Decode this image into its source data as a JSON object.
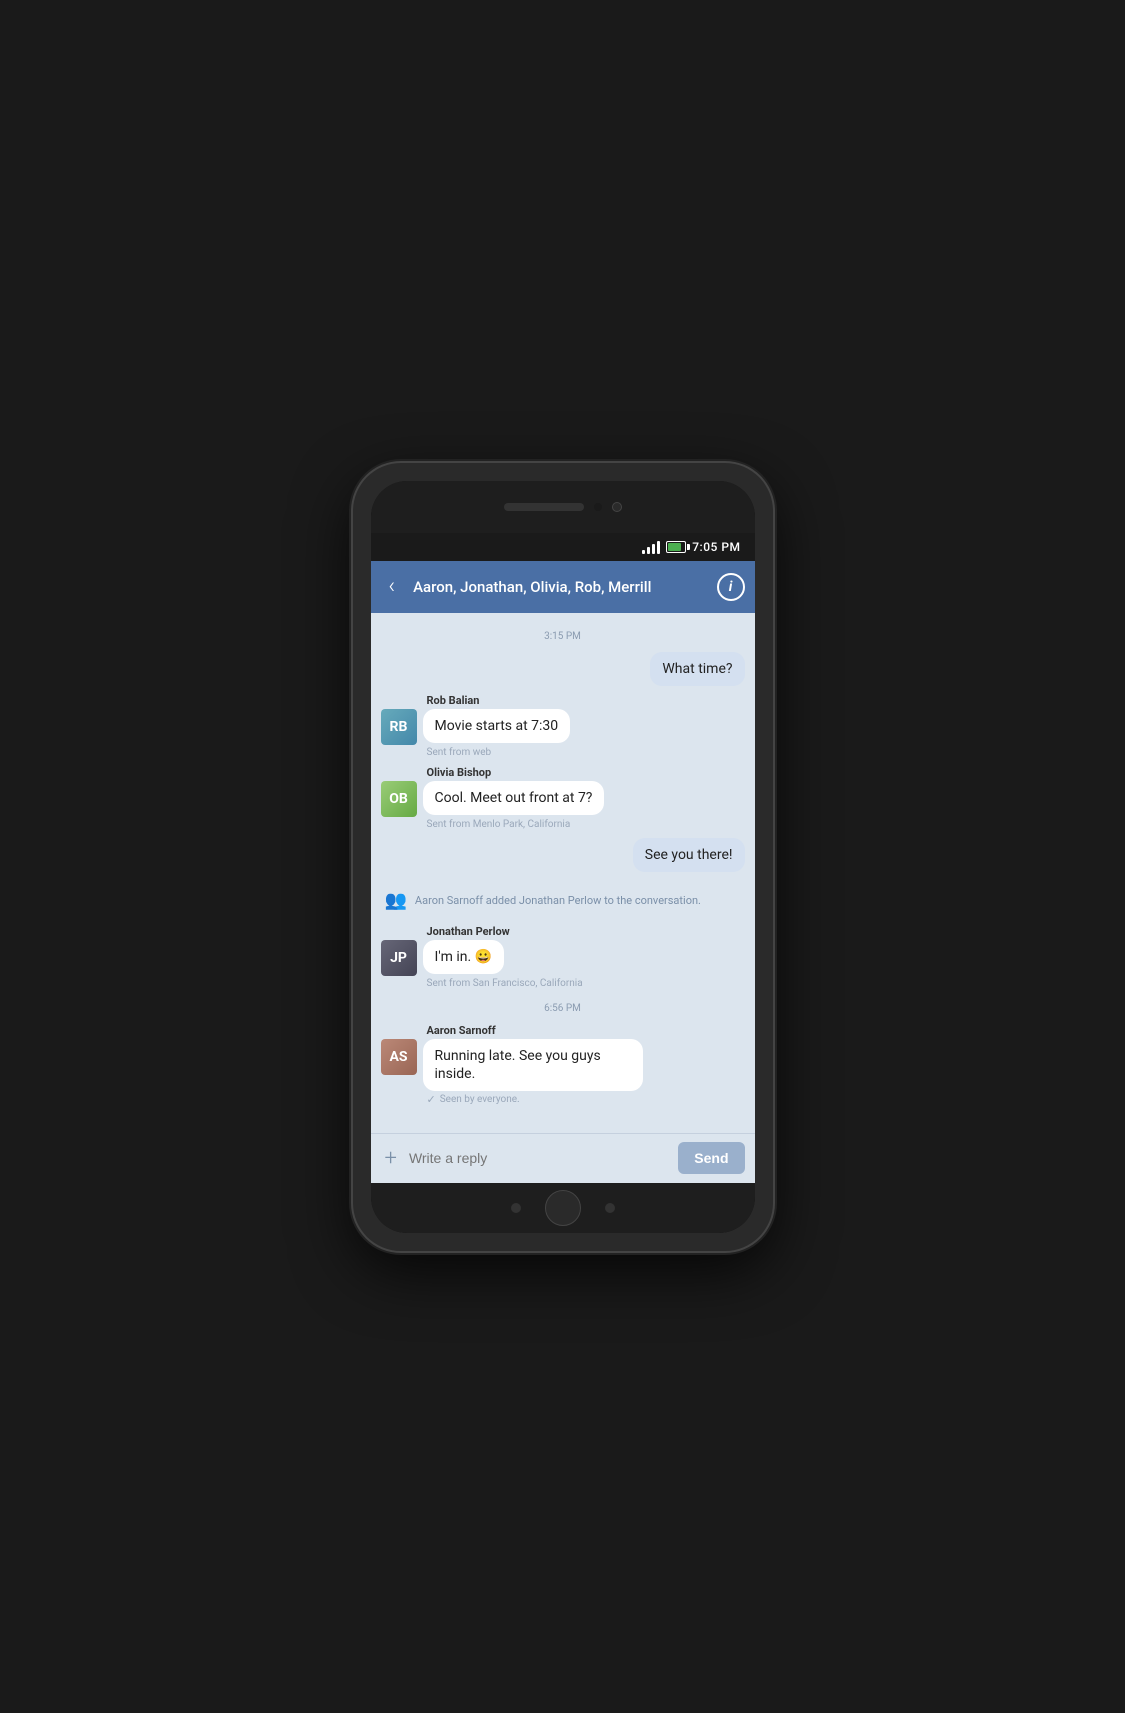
{
  "phone": {
    "status_bar": {
      "time": "7:05 PM"
    },
    "toolbar": {
      "back_label": "‹",
      "title": "Aaron, Jonathan, Olivia, Rob, Merrill",
      "info_label": "i"
    },
    "chat": {
      "timestamp1": "3:15 PM",
      "timestamp2": "6:56 PM",
      "messages": [
        {
          "id": "msg1",
          "type": "outgoing",
          "text": "What time?",
          "meta": ""
        },
        {
          "id": "msg2",
          "type": "incoming",
          "sender": "Rob Balian",
          "text": "Movie starts at 7:30",
          "meta": "Sent from web",
          "avatar_initials": "RB",
          "avatar_class": "avatar-rob"
        },
        {
          "id": "msg3",
          "type": "incoming",
          "sender": "Olivia Bishop",
          "text": "Cool. Meet out front at 7?",
          "meta": "Sent from Menlo Park, California",
          "avatar_initials": "OB",
          "avatar_class": "avatar-olivia"
        },
        {
          "id": "msg4",
          "type": "outgoing",
          "text": "See you there!",
          "meta": ""
        },
        {
          "id": "sys1",
          "type": "system",
          "text": "Aaron Sarnoff added Jonathan Perlow to the conversation."
        },
        {
          "id": "msg5",
          "type": "incoming",
          "sender": "Jonathan Perlow",
          "text": "I'm in. 😀",
          "meta": "Sent from San Francisco, California",
          "avatar_initials": "JP",
          "avatar_class": "avatar-jonathan"
        },
        {
          "id": "msg6",
          "type": "incoming",
          "sender": "Aaron Sarnoff",
          "text": "Running late. See you guys inside.",
          "meta": "",
          "avatar_initials": "AS",
          "avatar_class": "avatar-aaron",
          "seen": "Seen by everyone."
        }
      ]
    },
    "input": {
      "placeholder": "Write a reply",
      "send_label": "Send",
      "attach_label": "+"
    }
  }
}
